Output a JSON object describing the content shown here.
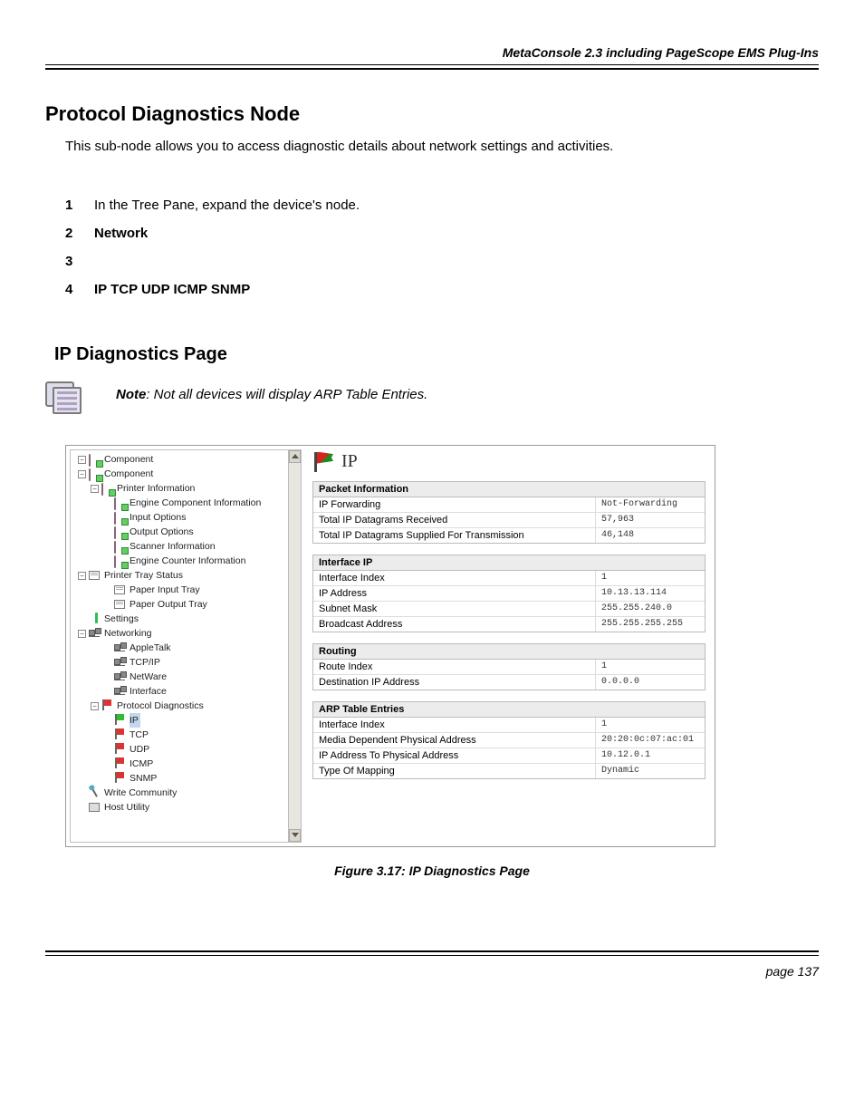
{
  "header": "MetaConsole 2.3 including PageScope EMS Plug-Ins",
  "footer": "page 137",
  "h_protocol": "Protocol Diagnostics Node",
  "intro": "This sub-node allows you to access diagnostic details about network settings and activities.",
  "steps": {
    "s1": "In the Tree Pane, expand the device's node.",
    "s2": "Network",
    "s3": "",
    "s4": "IP  TCP  UDP  ICMP     SNMP"
  },
  "h_ip": "IP Diagnostics Page",
  "note_bold": "Note",
  "note_rest": ": Not all devices will display ARP Table Entries.",
  "tree": {
    "component1": "Component",
    "component2": "Component",
    "printerInfo": "Printer Information",
    "engComp": "Engine Component Information",
    "inputOpt": "Input Options",
    "outputOpt": "Output Options",
    "scannerInfo": "Scanner Information",
    "engCounter": "Engine Counter Information",
    "ptStatus": "Printer Tray Status",
    "paperIn": "Paper Input Tray",
    "paperOut": "Paper Output Tray",
    "settings": "Settings",
    "networking": "Networking",
    "appletalk": "AppleTalk",
    "tcpip": "TCP/IP",
    "netware": "NetWare",
    "interface": "Interface",
    "protoDiag": "Protocol Diagnostics",
    "ip": "IP",
    "tcp": "TCP",
    "udp": "UDP",
    "icmp": "ICMP",
    "snmp": "SNMP",
    "writeComm": "Write Community",
    "hostUtil": "Host Utility"
  },
  "detail": {
    "title": "IP",
    "g1": {
      "head": "Packet Information",
      "r1k": "IP Forwarding",
      "r1v": "Not-Forwarding",
      "r2k": "Total IP Datagrams Received",
      "r2v": "57,963",
      "r3k": "Total IP Datagrams Supplied For Transmission",
      "r3v": "46,148"
    },
    "g2": {
      "head": "Interface IP",
      "r1k": "Interface Index",
      "r1v": "1",
      "r2k": "IP Address",
      "r2v": "10.13.13.114",
      "r3k": "Subnet Mask",
      "r3v": "255.255.240.0",
      "r4k": "Broadcast Address",
      "r4v": "255.255.255.255"
    },
    "g3": {
      "head": "Routing",
      "r1k": "Route Index",
      "r1v": "1",
      "r2k": "Destination IP Address",
      "r2v": "0.0.0.0"
    },
    "g4": {
      "head": "ARP Table Entries",
      "r1k": "Interface Index",
      "r1v": "1",
      "r2k": "Media Dependent Physical Address",
      "r2v": "20:20:0c:07:ac:01",
      "r3k": "IP Address To Physical Address",
      "r3v": "10.12.0.1",
      "r4k": "Type Of Mapping",
      "r4v": "Dynamic"
    }
  },
  "figcap": "Figure 3.17:  IP Diagnostics Page"
}
